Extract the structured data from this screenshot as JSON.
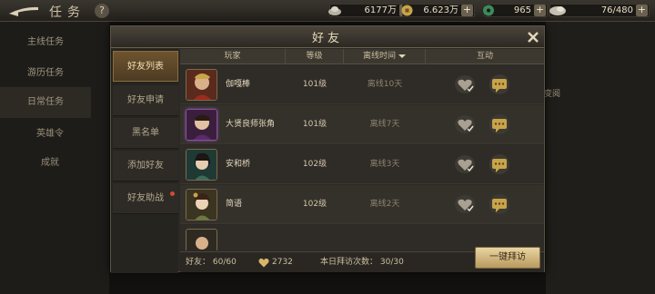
{
  "topbar": {
    "title": "任务",
    "help_label": "?",
    "resources": [
      {
        "name": "silver",
        "value": "6177万",
        "plus": "+",
        "icon": "silver-ingot-icon"
      },
      {
        "name": "gold",
        "value": "6.623万",
        "plus": "+",
        "icon": "gold-coin-icon"
      },
      {
        "name": "jade",
        "value": "965",
        "plus": "+",
        "icon": "jade-icon"
      },
      {
        "name": "stamina",
        "value": "76/480",
        "plus": "+",
        "icon": "stamina-icon"
      }
    ]
  },
  "background": {
    "nav": [
      "主线任务",
      "游历任务",
      "日常任务"
    ],
    "sub": [
      "英雄令",
      "成就"
    ],
    "right_label": "变阅"
  },
  "modal": {
    "title": "好友",
    "tabs": [
      {
        "label": "好友列表",
        "active": true,
        "dot": false
      },
      {
        "label": "好友申请",
        "active": false,
        "dot": false
      },
      {
        "label": "黑名单",
        "active": false,
        "dot": false
      },
      {
        "label": "添加好友",
        "active": false,
        "dot": false
      },
      {
        "label": "好友助战",
        "active": false,
        "dot": true
      }
    ],
    "columns": [
      "玩家",
      "等级",
      "离线时间",
      "互动"
    ],
    "rows": [
      {
        "name": "伽嘎棒",
        "level": "101级",
        "offline": "离线10天"
      },
      {
        "name": "大贤良师张角",
        "level": "101级",
        "offline": "离线7天"
      },
      {
        "name": "安和桥",
        "level": "102级",
        "offline": "离线3天"
      },
      {
        "name": "简语",
        "level": "102级",
        "offline": "离线2天"
      }
    ],
    "footer": {
      "friends_label": "好友： 60/60",
      "charm": "2732",
      "visits_label": "本日拜访次数： 30/30",
      "visit_all_label": "一键拜访"
    }
  },
  "colors": {
    "accent_gold": "#e8d4a2",
    "tab_active": "#6e5430",
    "alert_dot": "#d04a34"
  }
}
